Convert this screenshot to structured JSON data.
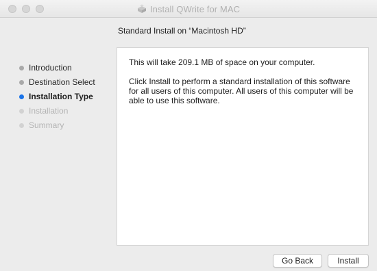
{
  "window": {
    "title": "Install QWrite for MAC",
    "title_icon": "installer-package-icon"
  },
  "header": {
    "subtitle": "Standard Install on “Macintosh HD”"
  },
  "sidebar": {
    "steps": [
      {
        "label": "Introduction",
        "state": "done"
      },
      {
        "label": "Destination Select",
        "state": "done"
      },
      {
        "label": "Installation Type",
        "state": "active"
      },
      {
        "label": "Installation",
        "state": "pending"
      },
      {
        "label": "Summary",
        "state": "pending"
      }
    ]
  },
  "main": {
    "space_text": "This will take 209.1 MB of space on your computer.",
    "description": "Click Install to perform a standard installation of this software for all users of this computer. All users of this computer will be able to use this software."
  },
  "buttons": {
    "back_label": "Go Back",
    "install_label": "Install"
  },
  "colors": {
    "active_step": "#1a73e8",
    "window_bg": "#ececec"
  }
}
